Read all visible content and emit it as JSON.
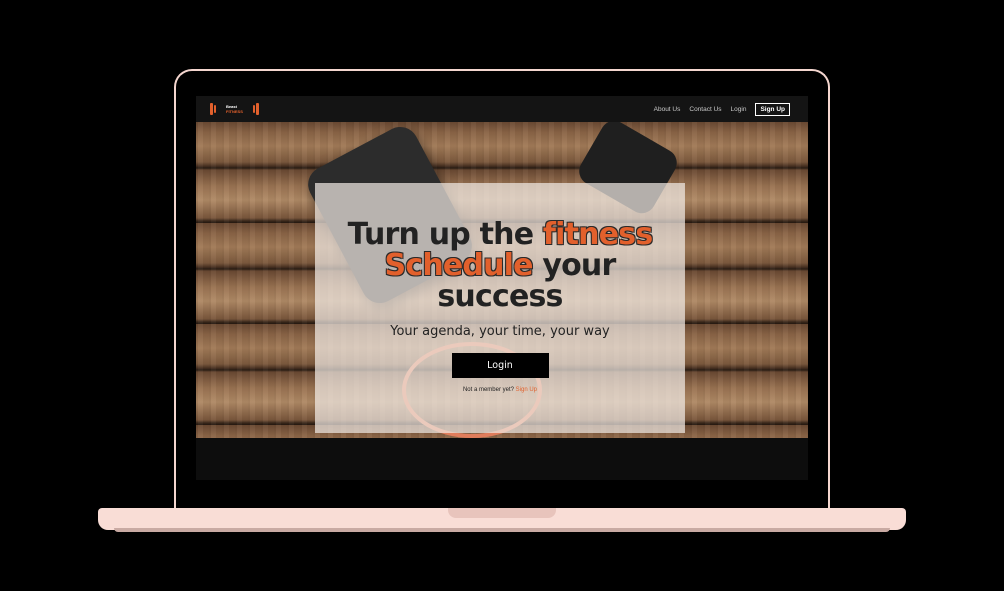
{
  "nav": {
    "logo": {
      "line1": "Beast",
      "line2": "FITNESS"
    },
    "links": [
      "About Us",
      "Contact Us",
      "Login"
    ],
    "signup": "Sign Up"
  },
  "hero": {
    "headline": {
      "part1": "Turn up the ",
      "accent1": "fitness",
      "accent2": "Schedule",
      "part2": " your",
      "part3": "success"
    },
    "subline": "Your agenda, your time, your way",
    "login_button": "Login",
    "member_prompt": "Not a member yet?",
    "member_link": "Sign Up"
  },
  "colors": {
    "accent": "#e2602c",
    "laptop_frame": "#f4d6cf",
    "background": "#000000"
  }
}
